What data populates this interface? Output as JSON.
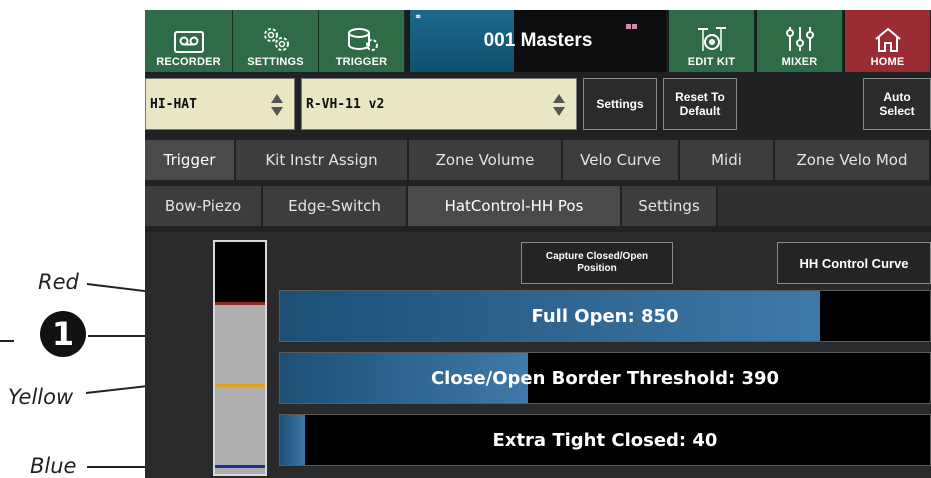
{
  "callouts": {
    "red": "Red",
    "yellow": "Yellow",
    "blue": "Blue",
    "badge": "1"
  },
  "topbar": {
    "recorder": "RECORDER",
    "settings": "SETTINGS",
    "trigger": "TRIGGER",
    "kit_name": "001 Masters",
    "edit_kit": "EDIT KIT",
    "mixer": "MIXER",
    "home": "HOME"
  },
  "selectors": {
    "instrument": "HI-HAT",
    "trigger_type": "R-VH-11 v2",
    "settings": "Settings",
    "reset": "Reset To Default",
    "auto_select": "Auto Select"
  },
  "tabs_primary": [
    "Trigger",
    "Kit Instr Assign",
    "Zone Volume",
    "Velo Curve",
    "Midi",
    "Zone Velo Mod"
  ],
  "tabs_secondary": [
    "Bow-Piezo",
    "Edge-Switch",
    "HatControl-HH Pos",
    "Settings"
  ],
  "controls": {
    "capture": "Capture Closed/Open Position",
    "hh_curve": "HH Control Curve"
  },
  "bars": [
    {
      "label": "Full Open: 850",
      "value": 850
    },
    {
      "label": "Close/Open Border Threshold: 390",
      "value": 390
    },
    {
      "label": "Extra Tight Closed: 40",
      "value": 40
    }
  ],
  "bar_max": 1023,
  "meter": {
    "level_fraction": 0.74,
    "markers": [
      {
        "name": "red",
        "color": "#8b2a22",
        "fraction": 0.74
      },
      {
        "name": "yellow",
        "color": "#e0a21a",
        "fraction": 0.39
      },
      {
        "name": "blue",
        "color": "#1a2ea8",
        "fraction": 0.04
      }
    ]
  },
  "colors": {
    "topbar_green": "#2f6b46",
    "home_red": "#9b2c33",
    "bar_fill": "#3f79a8",
    "selector_bg": "#e8e6c4"
  }
}
